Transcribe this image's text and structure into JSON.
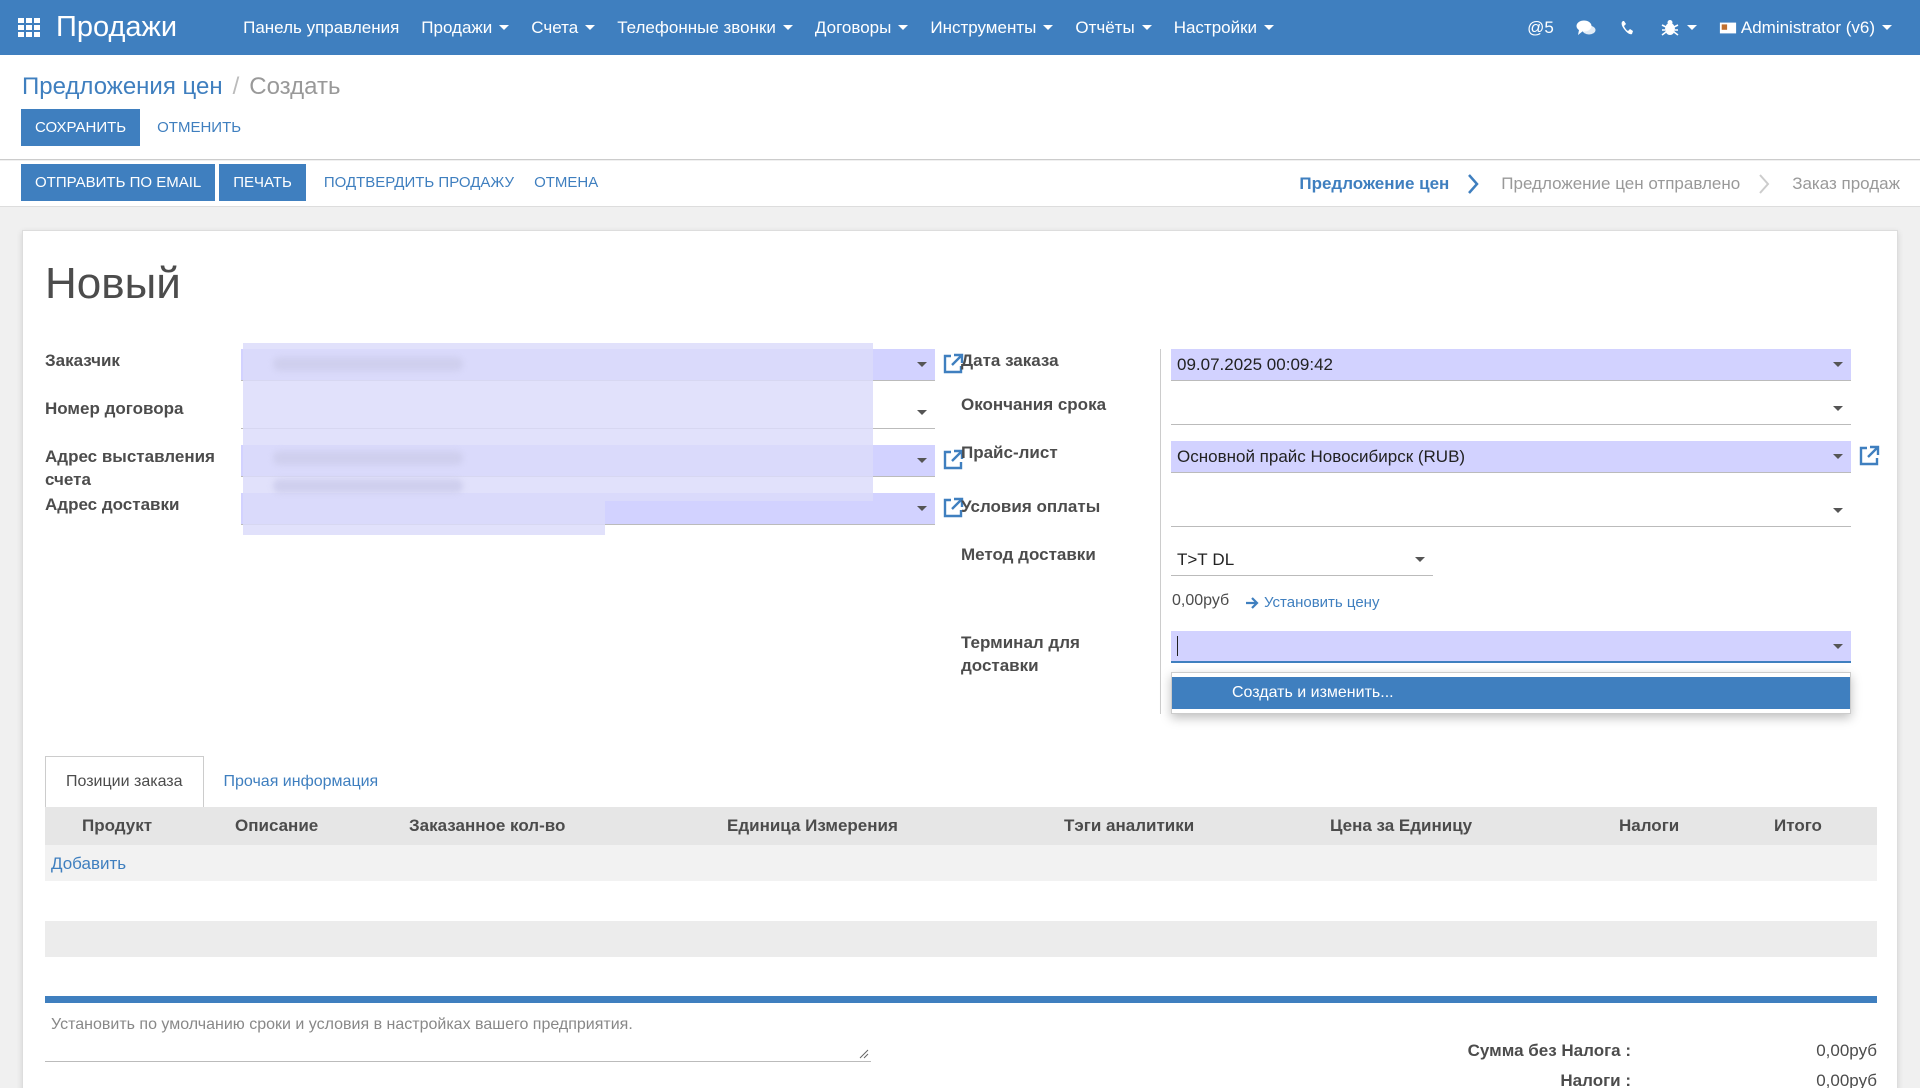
{
  "navbar": {
    "brand": "Продажи",
    "menu": [
      {
        "label": "Панель управления",
        "caret": false
      },
      {
        "label": "Продажи",
        "caret": true
      },
      {
        "label": "Счета",
        "caret": true
      },
      {
        "label": "Телефонные звонки",
        "caret": true
      },
      {
        "label": "Договоры",
        "caret": true
      },
      {
        "label": "Инструменты",
        "caret": true
      },
      {
        "label": "Отчёты",
        "caret": true
      },
      {
        "label": "Настройки",
        "caret": true
      }
    ],
    "mentions": "@5",
    "user": "Administrator (v6)"
  },
  "breadcrumb": {
    "parent": "Предложения цен",
    "sep": "/",
    "current": "Создать"
  },
  "control_buttons": {
    "save": "Сохранить",
    "discard": "Отменить"
  },
  "status_actions": {
    "send_email": "Отправить по Email",
    "print": "Печать",
    "confirm": "Подтвердить продажу",
    "cancel": "Отмена"
  },
  "stages": [
    "Предложение цен",
    "Предложение цен отправлено",
    "Заказ продаж"
  ],
  "form": {
    "title": "Новый",
    "left": {
      "customer_label": "Заказчик",
      "contract_label": "Номер договора",
      "invoice_address_label": "Адрес выставления счета",
      "delivery_address_label": "Адрес доставки"
    },
    "right": {
      "order_date_label": "Дата заказа",
      "order_date_value": "09.07.2025 00:09:42",
      "validity_label": "Окончания срока",
      "validity_value": "",
      "pricelist_label": "Прайс-лист",
      "pricelist_value": "Основной прайс Новосибирск (RUB)",
      "payment_terms_label": "Условия оплаты",
      "payment_terms_value": "",
      "delivery_method_label": "Метод доставки",
      "delivery_method_value": "Т>Т DL",
      "delivery_price": "0,00руб",
      "set_price_link": "Установить цену",
      "terminal_label": "Терминал для доставки",
      "terminal_dropdown_item": "Создать и изменить..."
    }
  },
  "tabs": [
    "Позиции заказа",
    "Прочая информация"
  ],
  "table": {
    "columns": [
      "Продукт",
      "Описание",
      "Заказанное кол-во",
      "Единица Измерения",
      "Тэги аналитики",
      "Цена за Единицу",
      "Налоги",
      "Итого"
    ],
    "add_link": "Добавить"
  },
  "note_placeholder": "Установить по умолчанию сроки и условия в настройках вашего предприятия.",
  "totals": {
    "untaxed_label": "Сумма без Налога :",
    "untaxed_value": "0,00руб",
    "taxes_label": "Налоги :",
    "taxes_value": "0,00руб"
  },
  "colors": {
    "primary": "#3f7fbf",
    "required_field": "#d2d2ff"
  }
}
